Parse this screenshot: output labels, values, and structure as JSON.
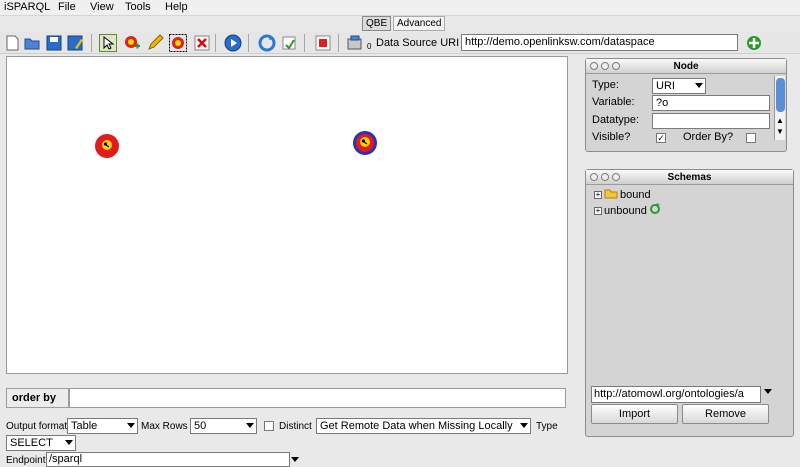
{
  "menu": {
    "app": "iSPARQL",
    "items": [
      "File",
      "View",
      "Tools",
      "Help"
    ]
  },
  "tabs": {
    "qbe": "QBE",
    "advanced": "Advanced"
  },
  "toolbar": {
    "icons": [
      "new-icon",
      "open-icon",
      "save-icon",
      "save-as-icon",
      "select-icon",
      "add-node-icon",
      "pencil-icon",
      "group-icon",
      "delete-icon",
      "run-icon",
      "refresh-icon",
      "load-icon",
      "clear-icon",
      "datasource-icon"
    ],
    "datasource_badge": "0",
    "datasource_label": "Data Source URI",
    "datasource_value": "http://demo.openlinksw.com/dataspace"
  },
  "canvas": {
    "nodes": [
      {
        "kind": "red"
      },
      {
        "kind": "blue-ring"
      }
    ]
  },
  "node_panel": {
    "title": "Node",
    "type_label": "Type:",
    "type_value": "URI",
    "variable_label": "Variable:",
    "variable_value": "?o",
    "datatype_label": "Datatype:",
    "datatype_value": "",
    "visible_label": "Visible?",
    "visible_checked": true,
    "orderby_label": "Order By?",
    "orderby_checked": false
  },
  "schemas_panel": {
    "title": "Schemas",
    "items": [
      {
        "label": "bound",
        "icon": "folder-icon"
      },
      {
        "label": "unbound",
        "icon": "refresh-icon"
      }
    ],
    "url_value": "http://atomowl.org/ontologies/a",
    "import_label": "Import",
    "remove_label": "Remove"
  },
  "bottom": {
    "orderby_label": "order by",
    "output_format_label": "Output format",
    "output_format_value": "Table",
    "max_rows_label": "Max Rows",
    "max_rows_value": "50",
    "distinct_label": "Distinct",
    "remote_data_value": "Get Remote Data when Missing Locally",
    "type_label": "Type",
    "type_value": "SELECT",
    "endpoint_label": "Endpoint",
    "endpoint_value": "/sparql"
  }
}
